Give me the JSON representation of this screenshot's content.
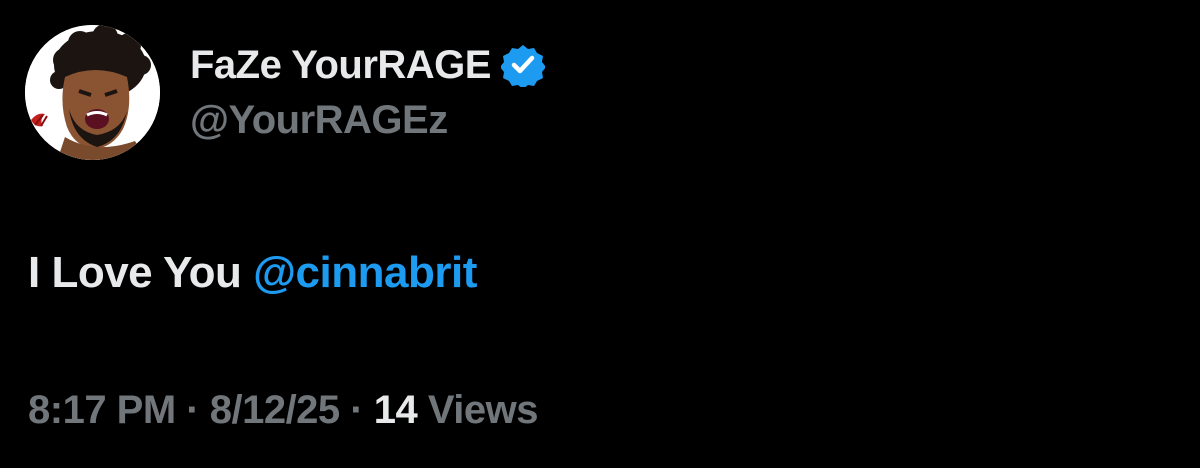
{
  "colors": {
    "background": "#000000",
    "primary_text": "#e7e9ea",
    "secondary_text": "#71767b",
    "accent": "#1d9bf0"
  },
  "author": {
    "display_name": "FaZe YourRAGE",
    "handle": "@YourRAGEz",
    "verified_icon": "verified-badge-icon",
    "avatar_icon": "cartoon-avatar"
  },
  "tweet": {
    "text": "I Love You ",
    "mention": "@cinnabrit"
  },
  "meta": {
    "time": "8:17 PM",
    "separator": " · ",
    "date": "8/12/25",
    "views_count": "14",
    "views_label": " Views"
  }
}
